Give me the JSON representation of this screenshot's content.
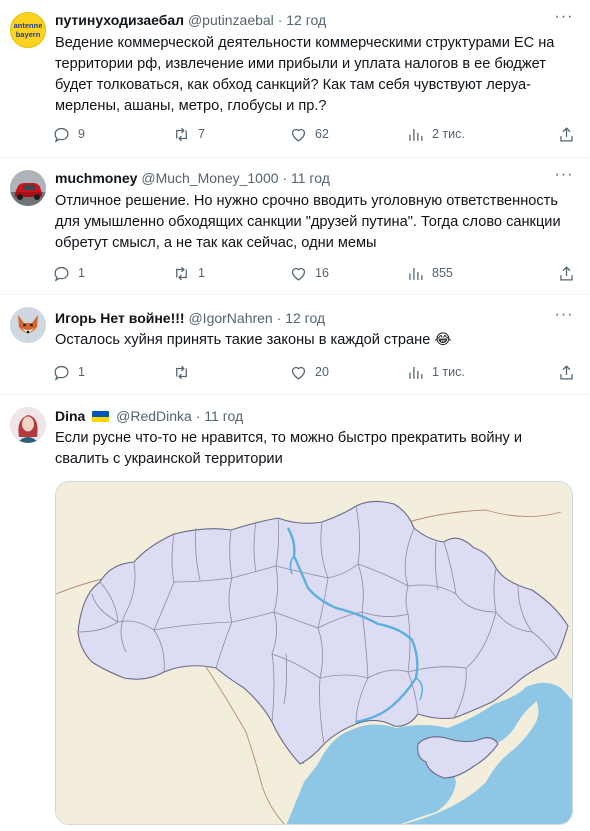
{
  "tweets": [
    {
      "name": "путинуходизаебал",
      "handle": "@putinzaebal",
      "sep": "·",
      "time": "12 год",
      "avatar_text_top": "antenne",
      "avatar_text_bottom": "bayern",
      "text": "Ведение коммерческой деятельности коммерческими структурами ЕС на территории рф, извлечение ими прибыли и уплата налогов в ее бюджет будет толковаться, как обход санкций? Как там себя чувствуют леруа-мерлены, ашаны, метро, глобусы и пр.?",
      "replies": "9",
      "retweets": "7",
      "likes": "62",
      "views": "2 тис."
    },
    {
      "name": "muchmoney",
      "handle": "@Much_Money_1000",
      "sep": "·",
      "time": "11 год",
      "text": "Отличное решение. Но нужно срочно вводить уголовную ответственность для умышленно обходящих санкции \"друзей путина\". Тогда слово санкции обретут смысл, а не так как сейчас, одни мемы",
      "replies": "1",
      "retweets": "1",
      "likes": "16",
      "views": "855"
    },
    {
      "name": "Игорь Нет войне!!!",
      "handle": "@IgorNahren",
      "sep": "·",
      "time": "12 год",
      "text": "Осталось хуйня принять такие законы в каждой стране 😂",
      "replies": "1",
      "retweets": "",
      "likes": "20",
      "views": "1 тис."
    },
    {
      "name": "Dina",
      "handle": "@RedDinka",
      "sep": "·",
      "time": "11 год",
      "text": "Если русне что-то не нравится, то можно быстро прекратить войну и свалить с украинской территории"
    }
  ],
  "icons": {
    "reply": "reply-icon",
    "retweet": "retweet-icon",
    "like": "heart-icon",
    "views": "views-icon",
    "share": "share-icon",
    "more": "more-icon"
  },
  "colors": {
    "text": "#0f1419",
    "secondary": "#536471",
    "divider": "#eff3f4",
    "map_land": "#dcdcf2",
    "map_water": "#9ecfea",
    "flag_blue": "#0057b7",
    "flag_yellow": "#ffd700"
  }
}
